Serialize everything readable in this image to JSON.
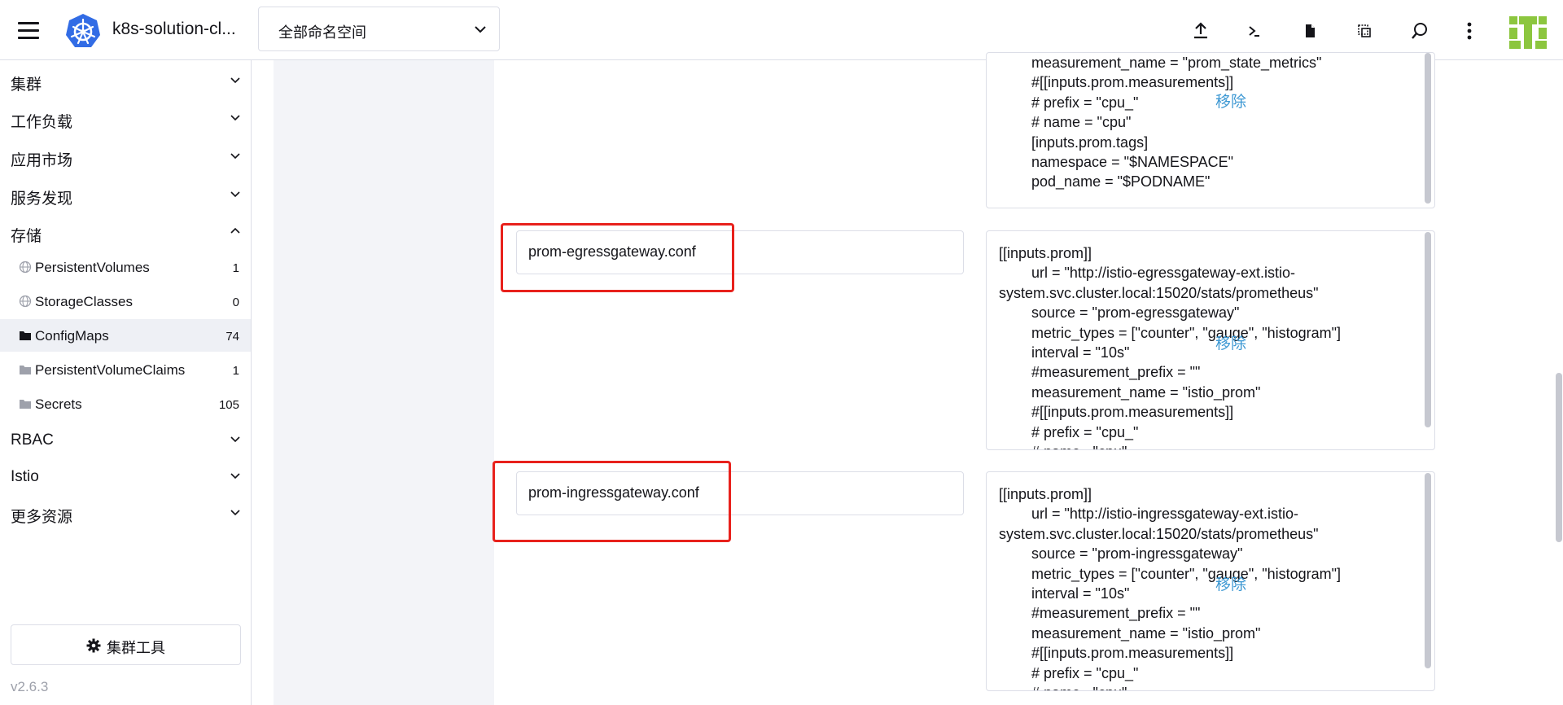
{
  "header": {
    "cluster_name": "k8s-solution-cl...",
    "namespace_selected": "全部命名空间",
    "icons": [
      "upload-icon",
      "terminal-icon",
      "file-icon",
      "copy-config-icon",
      "search-icon",
      "more-icon"
    ]
  },
  "sidebar": {
    "groups": [
      {
        "label": "集群"
      },
      {
        "label": "工作负载"
      },
      {
        "label": "应用市场"
      },
      {
        "label": "服务发现"
      },
      {
        "label": "存储"
      },
      {
        "label": "RBAC"
      },
      {
        "label": "Istio"
      },
      {
        "label": "更多资源"
      }
    ],
    "storage_items": [
      {
        "label": "PersistentVolumes",
        "count": "1"
      },
      {
        "label": "StorageClasses",
        "count": "0"
      },
      {
        "label": "ConfigMaps",
        "count": "74"
      },
      {
        "label": "PersistentVolumeClaims",
        "count": "1"
      },
      {
        "label": "Secrets",
        "count": "105"
      }
    ],
    "cluster_tools_label": "集群工具",
    "version": "v2.6.3"
  },
  "entries": [
    {
      "key": "",
      "value": "        measurement_name = \"prom_state_metrics\"\n        #[[inputs.prom.measurements]]\n        # prefix = \"cpu_\"\n        # name = \"cpu\"\n        [inputs.prom.tags]\n        namespace = \"$NAMESPACE\"\n        pod_name = \"$PODNAME\"",
      "remove_label": "移除"
    },
    {
      "key": "prom-egressgateway.conf",
      "value": "[[inputs.prom]]\n        url = \"http://istio-egressgateway-ext.istio-\nsystem.svc.cluster.local:15020/stats/prometheus\"\n        source = \"prom-egressgateway\"\n        metric_types = [\"counter\", \"gauge\", \"histogram\"]\n        interval = \"10s\"\n        #measurement_prefix = \"\"\n        measurement_name = \"istio_prom\"\n        #[[inputs.prom.measurements]]\n        # prefix = \"cpu_\"\n        # name =\"cpu\"",
      "remove_label": "移除"
    },
    {
      "key": "prom-ingressgateway.conf",
      "value": "[[inputs.prom]]\n        url = \"http://istio-ingressgateway-ext.istio-\nsystem.svc.cluster.local:15020/stats/prometheus\"\n        source = \"prom-ingressgateway\"\n        metric_types = [\"counter\", \"gauge\", \"histogram\"]\n        interval = \"10s\"\n        #measurement_prefix = \"\"\n        measurement_name = \"istio_prom\"\n        #[[inputs.prom.measurements]]\n        # prefix = \"cpu_\"\n        # name =\"cpu\"",
      "remove_label": "移除"
    }
  ],
  "colors": {
    "accent_link": "#3d98d3",
    "highlight_box": "#e8211c",
    "kubernetes_blue": "#326ce5",
    "avatar_green": "#8cc63f"
  }
}
